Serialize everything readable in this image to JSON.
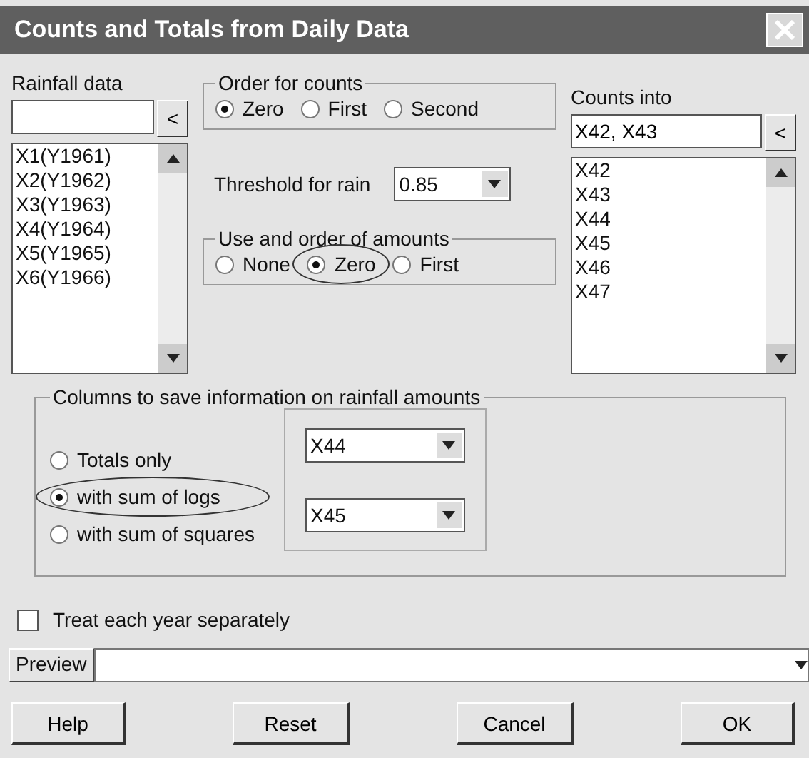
{
  "window": {
    "title": "Counts and Totals from Daily Data"
  },
  "rainfall_data": {
    "label": "Rainfall data",
    "add_button": "<",
    "items": [
      "X1(Y1961)",
      "X2(Y1962)",
      "X3(Y1963)",
      "X4(Y1964)",
      "X5(Y1965)",
      "X6(Y1966)"
    ]
  },
  "order_for_counts": {
    "label": "Order for counts",
    "options": [
      {
        "label": "Zero",
        "selected": true,
        "circled": false
      },
      {
        "label": "First",
        "selected": false,
        "circled": false
      },
      {
        "label": "Second",
        "selected": false,
        "circled": false
      }
    ]
  },
  "threshold": {
    "label": "Threshold for rain",
    "value": "0.85"
  },
  "use_and_order_of_amounts": {
    "label": "Use and order of amounts",
    "options": [
      {
        "label": "None",
        "selected": false,
        "circled": false
      },
      {
        "label": "Zero",
        "selected": true,
        "circled": true
      },
      {
        "label": "First",
        "selected": false,
        "circled": false
      }
    ]
  },
  "counts_into": {
    "label": "Counts into",
    "value": "X42, X43",
    "add_button": "<",
    "items": [
      "X42",
      "X43",
      "X44",
      "X45",
      "X46",
      "X47"
    ]
  },
  "columns_group": {
    "label": "Columns to save information on rainfall amounts",
    "options": [
      {
        "label": "Totals only",
        "selected": false,
        "circled": false
      },
      {
        "label": "with sum of logs",
        "selected": true,
        "circled": true
      },
      {
        "label": "with sum of squares",
        "selected": false,
        "circled": false
      }
    ],
    "columns": [
      "X44",
      "X45"
    ]
  },
  "treat_each_year": {
    "label": "Treat each year separately",
    "checked": false
  },
  "preview": {
    "label": "Preview"
  },
  "buttons": [
    "Help",
    "Reset",
    "Cancel",
    "OK"
  ]
}
